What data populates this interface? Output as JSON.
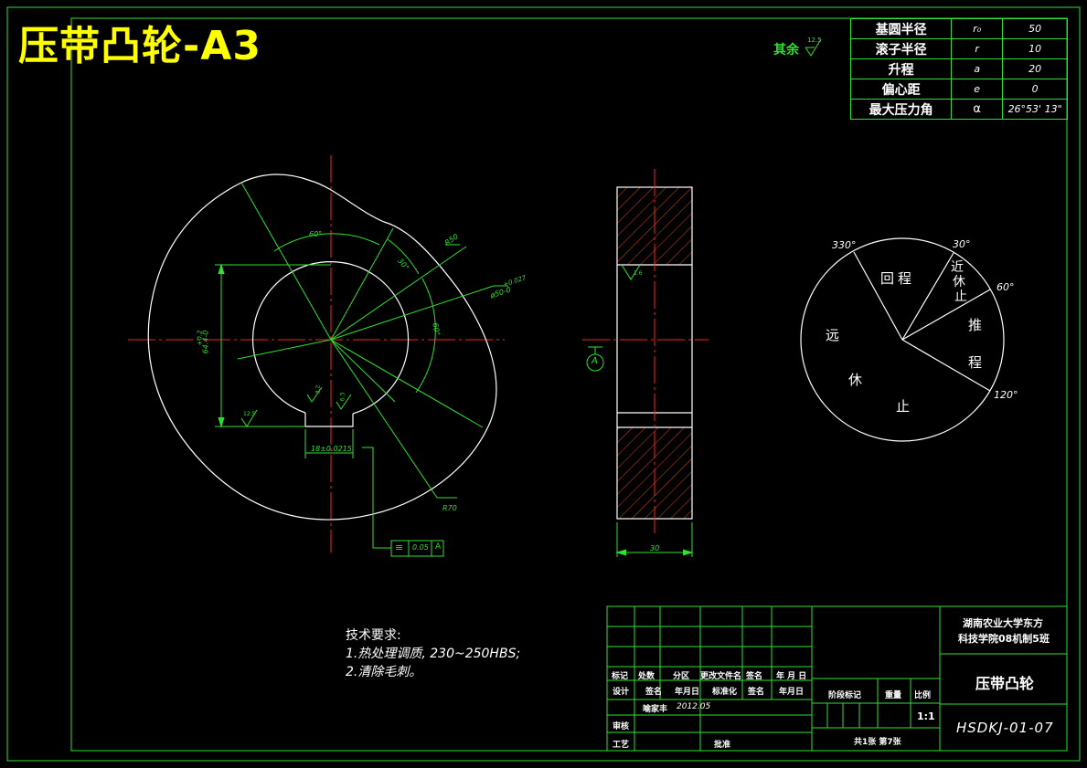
{
  "title": "压带凸轮-A3",
  "roughness_note": {
    "label": "其余",
    "value": "12.5"
  },
  "parameters": [
    {
      "name": "基圆半径",
      "symbol": "r₀",
      "value": "50"
    },
    {
      "name": "滚子半径",
      "symbol": "r",
      "value": "10"
    },
    {
      "name": "升程",
      "symbol": "a",
      "value": "20"
    },
    {
      "name": "偏心距",
      "symbol": "e",
      "value": "0"
    },
    {
      "name": "最大压力角",
      "symbol": "α",
      "value": "26°53' 13\""
    }
  ],
  "front_view": {
    "angle_60": "60°",
    "angle_30": "30°",
    "angle_60b": "60°",
    "r50": "R50",
    "bore": "ø50-0",
    "bore_tol": "+0.027",
    "dim_64": "64.4-0",
    "dim_64_tol": "+0.2",
    "keyway": "18±0.0215",
    "r70": "R70",
    "rough_1": "3.2",
    "rough_2": "6.3",
    "rough_3": "12.5",
    "tolerance_frame": {
      "symbol": "≡",
      "value": "0.05",
      "datum": "A"
    }
  },
  "side_view": {
    "width": "30",
    "datum": "A",
    "rough": "1.6"
  },
  "motion_diagram": {
    "angles": [
      "330°",
      "30°",
      "60°",
      "120°"
    ],
    "segments": {
      "return": "回程",
      "near_dwell": [
        "近",
        "休",
        "止"
      ],
      "push": [
        "推",
        "程"
      ],
      "far_dwell": [
        "远",
        "休",
        "止"
      ]
    }
  },
  "tech_requirements": {
    "heading": "技术要求:",
    "items": [
      "1.热处理调质, 230~250HBS;",
      "2.清除毛刺。"
    ]
  },
  "title_block": {
    "school": [
      "湖南农业大学东方",
      "科技学院08机制5班"
    ],
    "part_name": "压带凸轮",
    "drawing_no": "HSDKJ-01-07",
    "row_headers": [
      "标记",
      "处数",
      "分区",
      "更改文件名",
      "签名",
      "年 月 日"
    ],
    "design_row": [
      "设计",
      "签名",
      "年月日",
      "标准化",
      "签名",
      "年月日"
    ],
    "designer": "喻家丰",
    "date": "2012.05",
    "review": "审核",
    "process": "工艺",
    "approve": "批准",
    "stage_mark": "阶段标记",
    "weight": "重量",
    "scale_label": "比例",
    "scale": "1:1",
    "sheets": "共1张 第7张"
  },
  "colors": {
    "line": "#2fe02f",
    "outline": "#ffffff",
    "center": "#ff2020",
    "title": "#ffff00"
  }
}
